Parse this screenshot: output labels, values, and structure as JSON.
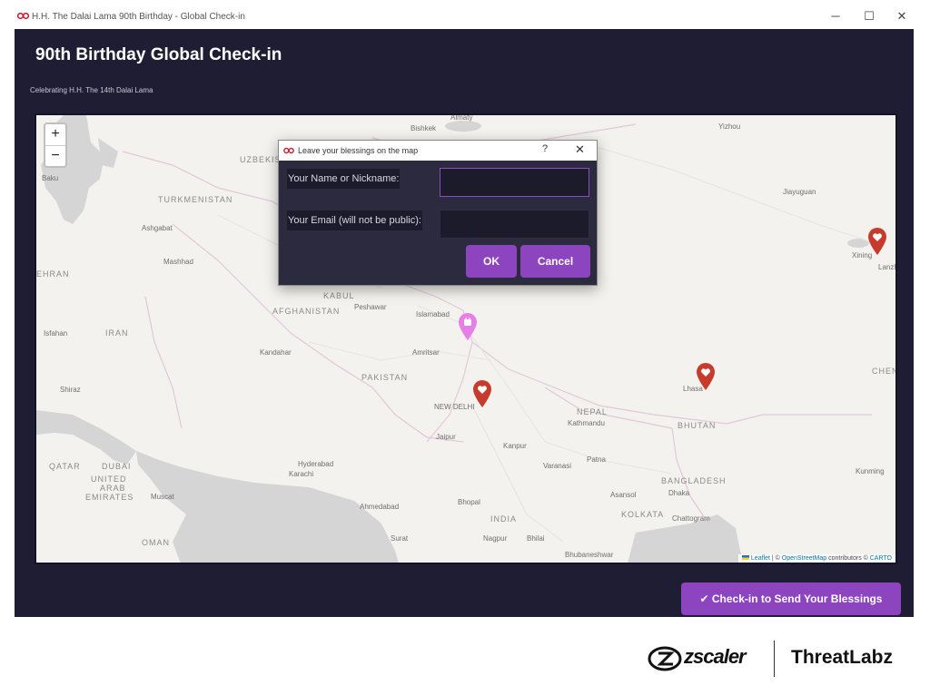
{
  "window": {
    "title": "H.H. The Dalai Lama 90th Birthday - Global Check-in",
    "controls": {
      "minimize": "─",
      "maximize": "☐",
      "close": "✕"
    }
  },
  "header": {
    "title": "90th Birthday Global Check-in",
    "subtitle": "Celebrating H.H. The 14th Dalai Lama"
  },
  "map": {
    "zoom_in": "+",
    "zoom_out": "−",
    "labels": {
      "bishkek": "Bishkek",
      "almaty": "Almaty",
      "yizhou": "Yizhou",
      "baku": "Baku",
      "uzbekistan": "UZBEKIS",
      "turkmenistan": "TURKMENISTAN",
      "jiayuguan": "Jiayuguan",
      "ashgabat": "Ashgabat",
      "mashhad": "Mashhad",
      "xining": "Xining",
      "lanzhou": "Lanzh",
      "tehran": "EHRAN",
      "kabul": "KABUL",
      "afghanistan": "AFGHANISTAN",
      "peshawar": "Peshawar",
      "islamabad": "Islamabad",
      "isfahan": "Isfahan",
      "iran": "IRAN",
      "kandahar": "Kandahar",
      "amritsar": "Amritsar",
      "pakistan": "PAKISTAN",
      "shiraz": "Shiraz",
      "chengdu": "CHENG",
      "lhasa": "Lhasa",
      "new_delhi": "NEW DELHI",
      "nepal": "NEPAL",
      "kathmandu": "Kathmandu",
      "bhutan": "BHUTAN",
      "jaipur": "Jaipur",
      "kanpur": "Kanpur",
      "qatar": "QATAR",
      "dubai": "DUBAI",
      "uae1": "UNITED",
      "uae2": "ARAB",
      "uae3": "EMIRATES",
      "hyderabad": "Hyderabad",
      "karachi": "Karachi",
      "varanasi": "Varanasi",
      "patna": "Patna",
      "bangladesh": "BANGLADESH",
      "kunming": "Kunming",
      "muscat": "Muscat",
      "ahmedabad": "Ahmedabad",
      "bhopal": "Bhopal",
      "asansol": "Asansol",
      "dhaka": "Dhaka",
      "india": "INDIA",
      "kolkata": "KOLKATA",
      "chattogram": "Chattogram",
      "oman": "OMAN",
      "surat": "Surat",
      "nagpur": "Nagpur",
      "bhilai": "Bhilai",
      "bhubaneswar": "Bhubaneshwar"
    },
    "attribution": {
      "leaflet": "Leaflet",
      "sep": " | © ",
      "osm": "OpenStreetMap",
      "contrib": " contributors © ",
      "carto": "CARTO"
    },
    "marker_colors": {
      "heart": "#c63b2b",
      "current": "#e87fe8"
    }
  },
  "dialog": {
    "title": "Leave your blessings on the map",
    "help": "?",
    "close": "✕",
    "name_label": "Your Name or Nickname:",
    "name_value": "",
    "email_label": "Your Email (will not be public):",
    "email_value": "",
    "ok": "OK",
    "cancel": "Cancel"
  },
  "checkin_button": "✔ Check-in to Send Your Blessings",
  "footer": {
    "brand1": "zscaler",
    "brand2": "ThreatLabz"
  },
  "colors": {
    "accent": "#8d44bf",
    "app_bg": "#1e1d33"
  }
}
